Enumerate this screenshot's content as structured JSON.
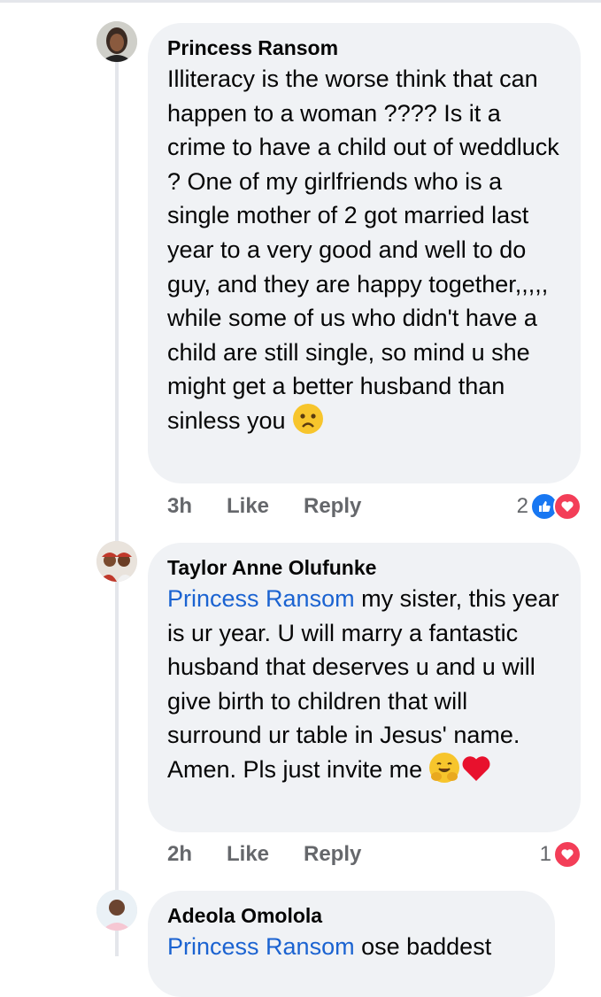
{
  "comments": [
    {
      "author": "Princess Ransom",
      "mention": "",
      "text": "Illiteracy is the worse think that can happen to a woman ???? Is it a crime to have a child out of weddluck ?  One of my girlfriends who is a single mother of 2 got married last year to a very good and well to do guy, and they are happy together,,,,, while some of us who didn't have a child are still single, so mind u she might get a better husband than sinless you",
      "time": "3h",
      "like_label": "Like",
      "reply_label": "Reply",
      "reaction_count": "2",
      "reactions": [
        "like-icon",
        "love-icon"
      ],
      "trailing_emoji": "worried-face-icon"
    },
    {
      "author": "Taylor Anne Olufunke",
      "mention": "Princess Ransom",
      "text": " my sister, this year is ur year. U will marry a fantastic husband that deserves u and u will give birth to children that will surround ur table in Jesus' name. Amen. Pls just invite me",
      "time": "2h",
      "like_label": "Like",
      "reply_label": "Reply",
      "reaction_count": "1",
      "reactions": [
        "love-icon"
      ],
      "trailing_emoji": "hugging-face-and-heart-icon"
    },
    {
      "author": "Adeola Omolola",
      "mention": "Princess Ransom",
      "text": " ose baddest"
    }
  ],
  "colors": {
    "bubble": "#f0f2f5",
    "mention": "#1b63d1",
    "meta": "#65676b",
    "like_reaction": "#1877f2",
    "love_reaction": "#f33e58"
  }
}
